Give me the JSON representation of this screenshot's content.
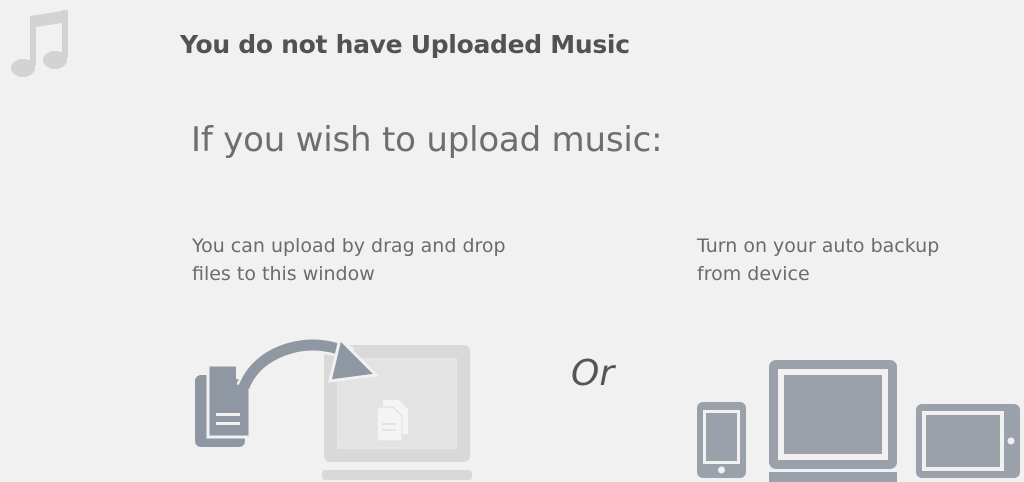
{
  "header": {
    "icon": "music-note-icon",
    "title": "You do not have Uploaded Music"
  },
  "main": {
    "subtitle": "If you wish to upload music:",
    "left": {
      "line1": "You can upload by drag and drop",
      "line2": "files to this window",
      "illustration": "drag-drop-illustration"
    },
    "or_label": "Or",
    "right": {
      "line1": "Turn on your auto backup",
      "line2": "from device",
      "illustration": "devices-illustration"
    }
  },
  "colors": {
    "background": "#f1f1f1",
    "icon_gray": "#9aa1ab",
    "light_gray": "#d6d6d6"
  }
}
